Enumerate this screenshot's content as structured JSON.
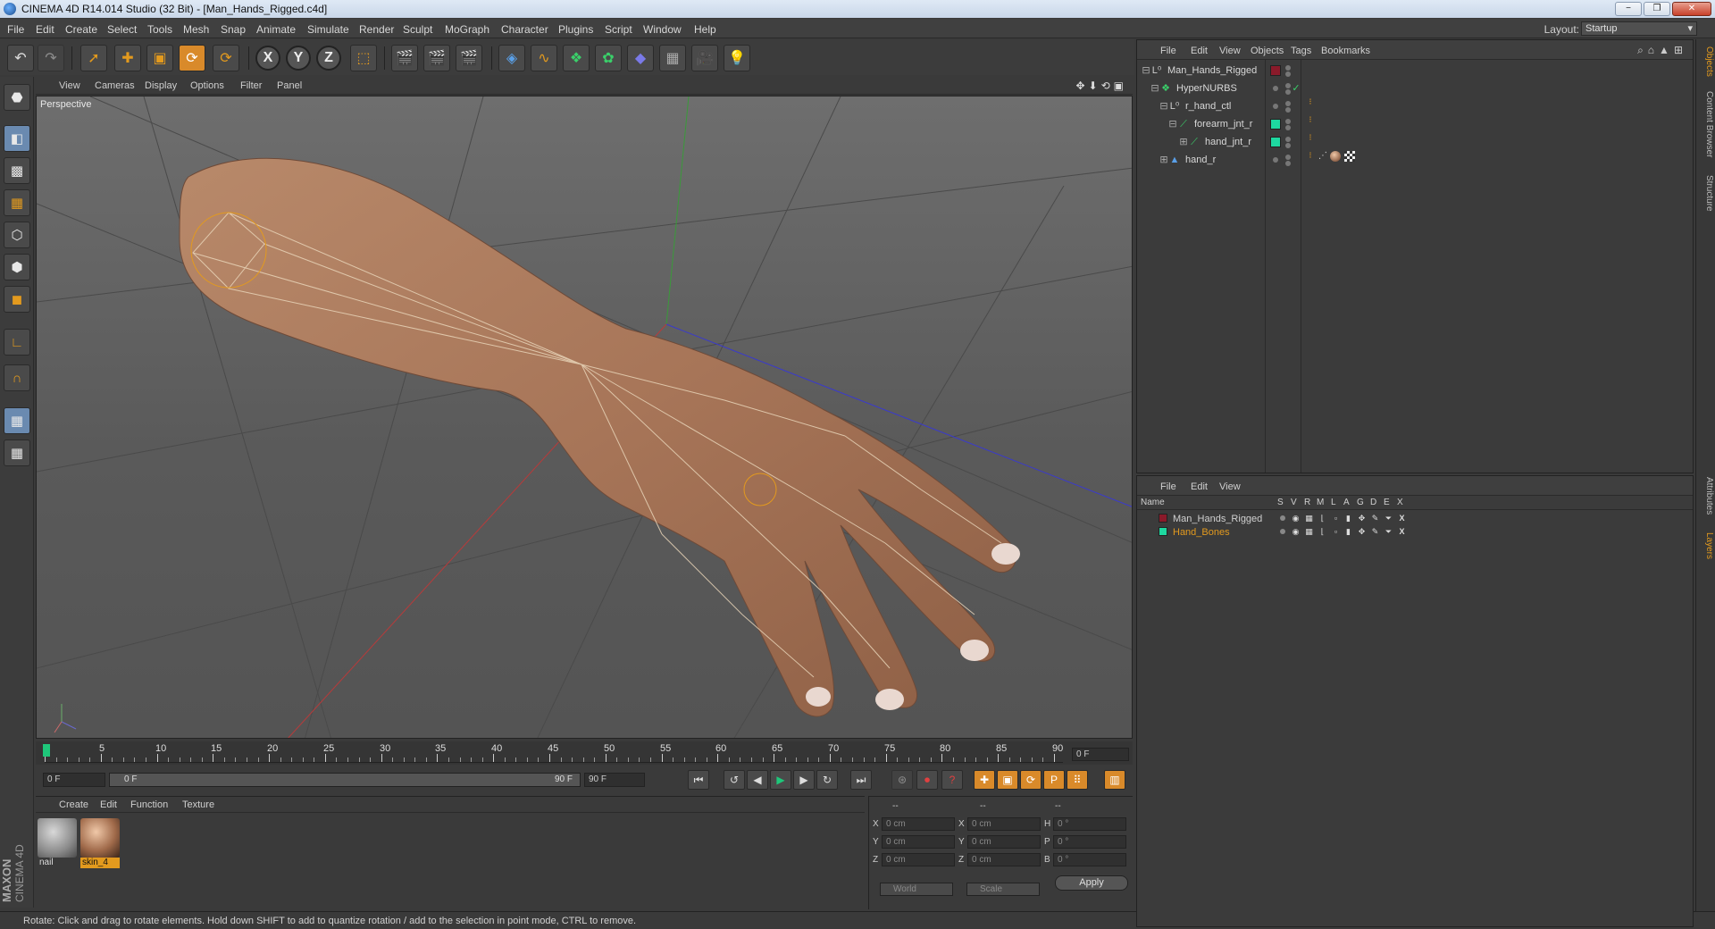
{
  "window": {
    "title": "CINEMA 4D R14.014 Studio (32 Bit) - [Man_Hands_Rigged.c4d]",
    "buttons": [
      "−",
      "❐",
      "✕"
    ]
  },
  "menu": [
    "File",
    "Edit",
    "Create",
    "Select",
    "Tools",
    "Mesh",
    "Snap",
    "Animate",
    "Simulate",
    "Render",
    "Sculpt",
    "MoGraph",
    "Character",
    "Plugins",
    "Script",
    "Window",
    "Help"
  ],
  "layout": {
    "label": "Layout:",
    "value": "Startup"
  },
  "toolbar": {
    "axes": [
      "X",
      "Y",
      "Z"
    ]
  },
  "viewport": {
    "menu": [
      "View",
      "Cameras",
      "Display",
      "Options",
      "Filter",
      "Panel"
    ],
    "label": "Perspective",
    "nav_icons": "✥⬇⟲▣"
  },
  "timeline": {
    "ticks": [
      "0",
      "5",
      "10",
      "15",
      "20",
      "25",
      "30",
      "35",
      "40",
      "45",
      "50",
      "55",
      "60",
      "65",
      "70",
      "75",
      "80",
      "85",
      "90"
    ],
    "current_frame": "0 F"
  },
  "transport": {
    "start": "0 F",
    "range_start": "0 F",
    "range_end": "90 F",
    "end": "90 F"
  },
  "materials": {
    "menu": [
      "Create",
      "Edit",
      "Function",
      "Texture"
    ],
    "items": [
      {
        "name": "nail",
        "selected": false
      },
      {
        "name": "skin_4",
        "selected": true
      }
    ]
  },
  "coordinates": {
    "header": [
      "--",
      "--",
      "--"
    ],
    "rows": [
      {
        "a": "X",
        "v1": "0 cm",
        "b": "X",
        "v2": "0 cm",
        "c": "H",
        "v3": "0 °"
      },
      {
        "a": "Y",
        "v1": "0 cm",
        "b": "Y",
        "v2": "0 cm",
        "c": "P",
        "v3": "0 °"
      },
      {
        "a": "Z",
        "v1": "0 cm",
        "b": "Z",
        "v2": "0 cm",
        "c": "B",
        "v3": "0 °"
      }
    ],
    "mode": "World",
    "scale": "Scale",
    "apply": "Apply"
  },
  "status": "Rotate: Click and drag to rotate elements. Hold down SHIFT to add to quantize rotation / add to the selection in point mode, CTRL to remove.",
  "objects": {
    "menu": [
      "File",
      "Edit",
      "View",
      "Objects",
      "Tags",
      "Bookmarks"
    ],
    "rows": [
      {
        "name": "Man_Hands_Rigged",
        "icon": "null-icon",
        "layer_color": "#8a1a2a"
      },
      {
        "name": "HyperNURBS",
        "icon": "hypernurbs-icon",
        "layer_color": ""
      },
      {
        "name": "r_hand_ctl",
        "icon": "null-icon",
        "layer_color": ""
      },
      {
        "name": "forearm_jnt_r",
        "icon": "joint-icon",
        "layer_color": "#1ed8a0"
      },
      {
        "name": "hand_jnt_r",
        "icon": "joint-icon",
        "layer_color": "#1ed8a0"
      },
      {
        "name": "hand_r",
        "icon": "polygon-icon",
        "layer_color": ""
      }
    ]
  },
  "layers": {
    "menu": [
      "File",
      "Edit",
      "View"
    ],
    "columns": [
      "Name",
      "S",
      "V",
      "R",
      "M",
      "L",
      "A",
      "G",
      "D",
      "E",
      "X"
    ],
    "rows": [
      {
        "name": "Man_Hands_Rigged",
        "color": "#8a1a2a",
        "text_color": "#d0d0d0"
      },
      {
        "name": "Hand_Bones",
        "color": "#1ed8a0",
        "text_color": "#e39a1e"
      }
    ]
  },
  "side_tabs": [
    "Objects",
    "Content Browser",
    "Structure",
    "Attributes",
    "Layers"
  ],
  "brand": {
    "line1": "MAXON",
    "line2": "CINEMA 4D"
  }
}
